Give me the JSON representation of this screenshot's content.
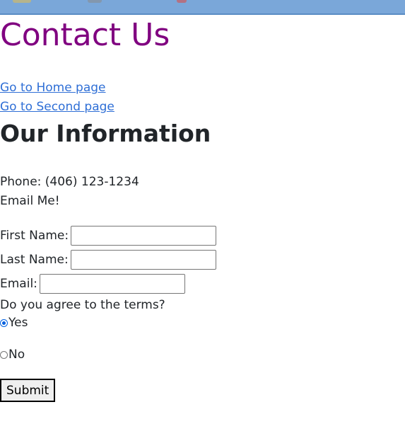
{
  "page": {
    "title": "Contact Us",
    "nav_links": [
      "Go to Home page",
      "Go to Second page"
    ],
    "section_heading": "Our Information",
    "phone": "Phone: (406) 123-1234",
    "email_link": "Email Me!"
  },
  "form": {
    "first_name_label": "First Name:",
    "first_name_value": "",
    "last_name_label": "Last Name:",
    "last_name_value": "",
    "email_label": "Email:",
    "email_value": "",
    "terms_question": "Do you agree to the terms?",
    "options": [
      {
        "label": "Yes",
        "checked": true
      },
      {
        "label": "No",
        "checked": false
      }
    ],
    "submit_label": "Submit"
  },
  "colors": {
    "title": "#800080",
    "link": "#2f6fd6",
    "browser_bar": "#7aa7d9"
  }
}
